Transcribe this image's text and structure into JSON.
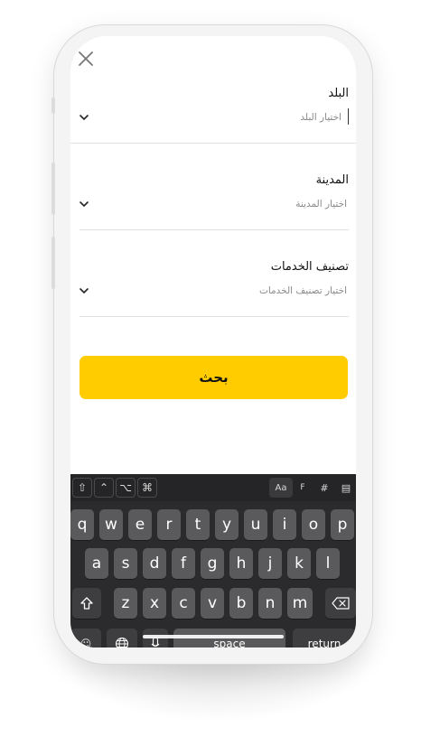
{
  "form": {
    "country": {
      "label": "البلد",
      "placeholder": "اختيار البلد"
    },
    "city": {
      "label": "المدينة",
      "placeholder": "اختيار المدينة"
    },
    "service": {
      "label": "تصنيف الخدمات",
      "placeholder": "اختيار تصنيف الخدمات"
    },
    "search_label": "بحث"
  },
  "keyboard": {
    "toolbar_left": [
      "⇧",
      "⌃",
      "⌥",
      "⌘"
    ],
    "toolbar_right": [
      "Aa",
      "F",
      "#",
      "▤"
    ],
    "row1": [
      "q",
      "w",
      "e",
      "r",
      "t",
      "y",
      "u",
      "i",
      "o",
      "p"
    ],
    "row2": [
      "a",
      "s",
      "d",
      "f",
      "g",
      "h",
      "j",
      "k",
      "l"
    ],
    "row3": [
      "z",
      "x",
      "c",
      "v",
      "b",
      "n",
      "m"
    ],
    "space_label": "space",
    "return_label": "return",
    "shift_icon": "shift-icon",
    "backspace_icon": "backspace-icon",
    "globe_icon": "globe-icon",
    "mic_icon": "mic-icon"
  },
  "colors": {
    "accent": "#FFCC00",
    "keyboard_bg": "#2b2b2d",
    "key_bg": "#5a5a5c"
  }
}
